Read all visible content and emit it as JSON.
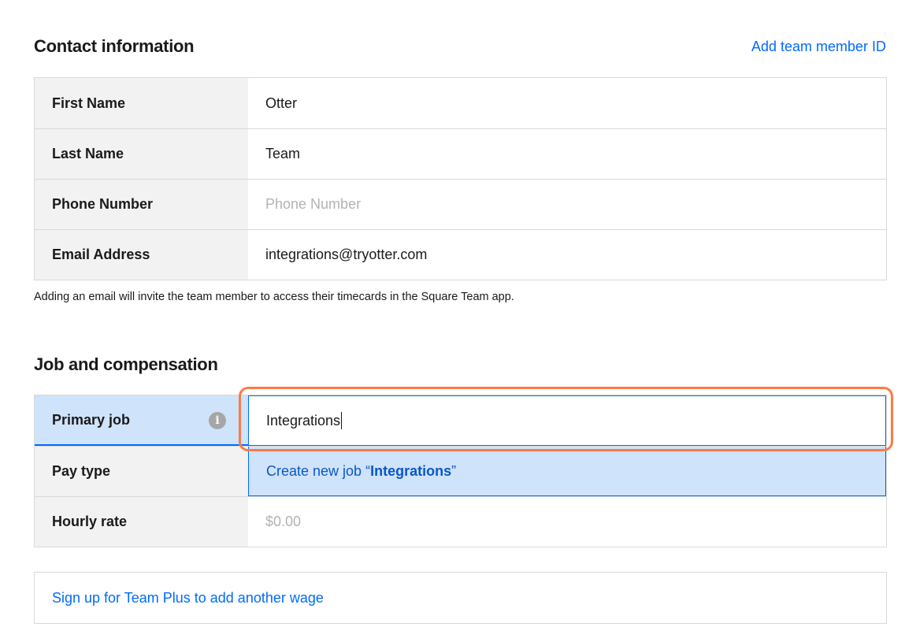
{
  "contact": {
    "title": "Contact information",
    "add_id_link": "Add team member ID",
    "fields": [
      {
        "label": "First Name",
        "value": "Otter"
      },
      {
        "label": "Last Name",
        "value": "Team"
      },
      {
        "label": "Phone Number",
        "placeholder": "Phone Number"
      },
      {
        "label": "Email Address",
        "value": "integrations@tryotter.com"
      }
    ],
    "note": "Adding an email will invite the team member to access their timecards in the Square Team app."
  },
  "job": {
    "title": "Job and compensation",
    "primary_job_label": "Primary job",
    "primary_job_value": "Integrations",
    "suggestion_prefix": "Create new job “",
    "suggestion_term": "Integrations",
    "suggestion_suffix": "”",
    "pay_type_label": "Pay type",
    "hourly_rate_label": "Hourly rate",
    "hourly_rate_placeholder": "$0.00"
  },
  "wage_link": "Sign up for Team Plus to add another wage",
  "colors": {
    "accent": "#006aff",
    "highlight": "#ff7a45",
    "selection_bg": "#cfe3fb"
  },
  "icons": {
    "primary_job_info": "info-icon"
  }
}
